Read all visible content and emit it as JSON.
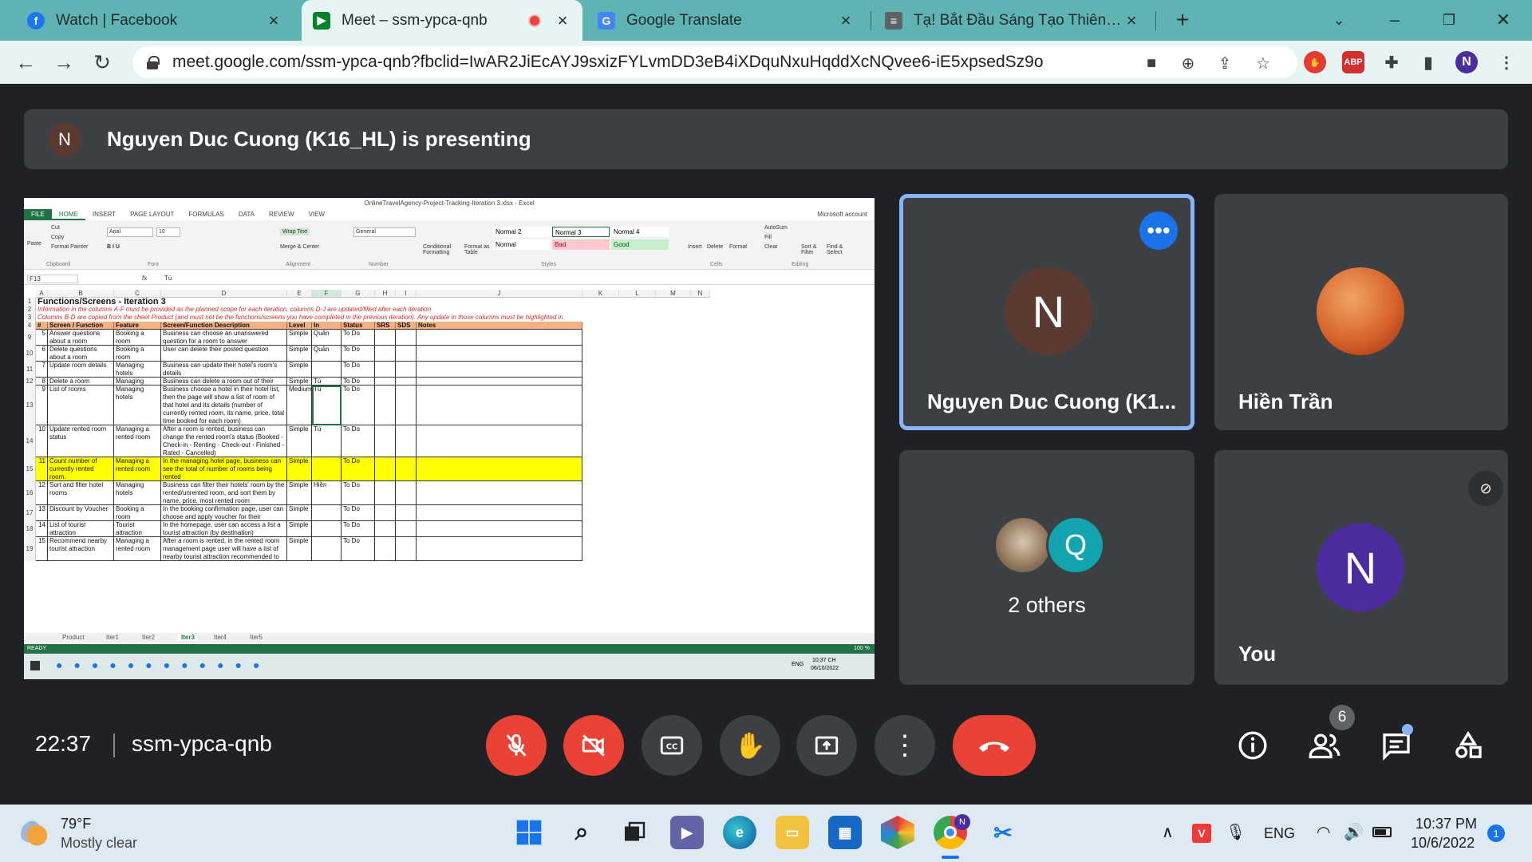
{
  "browser": {
    "tabs": [
      {
        "title": "Watch | Facebook",
        "icon": "facebook-icon",
        "color": "#1877f2"
      },
      {
        "title": "Meet – ssm-ypca-qnb",
        "icon": "google-meet-icon",
        "color": "#00832d",
        "recording": true
      },
      {
        "title": "Google Translate",
        "icon": "google-translate-icon",
        "color": "#4285f4"
      },
      {
        "title": "Tạ! Bắt Đầu Sáng Tạo Thiên Cơ L",
        "icon": "news-icon",
        "color": "#5f6368"
      }
    ],
    "new_tab_label": "+",
    "url": "meet.google.com/ssm-ypca-qnb?fbclid=IwAR2JiEcAYJ9sxizFYLvmDD3eB4iXDquNxuHqddXcNQvee6-iE5xpsedSz9o",
    "profile_initial": "N",
    "extensions": [
      {
        "name": "hand-extension-icon",
        "label": "✋",
        "color": "#e53935"
      },
      {
        "name": "adblock-plus-icon",
        "label": "ABP",
        "color": "#d32f2f"
      }
    ]
  },
  "meet": {
    "presenting_initial": "N",
    "presenting_text": "Nguyen Duc Cuong (K16_HL) is presenting",
    "participants": [
      {
        "name": "Nguyen Duc Cuong (K1...",
        "initial": "N",
        "color": "#5b3a32",
        "active": true
      },
      {
        "name": "Hiền Trần",
        "initial": "",
        "color": "#d3693a"
      },
      {
        "name": "2 others",
        "initial": "Q",
        "color": "#12a4af"
      },
      {
        "name": "You",
        "initial": "N",
        "color": "#4a2c9e",
        "muted": true
      }
    ],
    "time": "22:37",
    "meeting_code": "ssm-ypca-qnb",
    "people_count": "6",
    "colors": {
      "danger": "#ea4335",
      "control_bg": "#3c4043",
      "active_border": "#8ab4f8"
    }
  },
  "excel": {
    "title": "OnlineTravelAgency-Project-Tracking-Iteration 3.xlsx - Excel",
    "account": "Microsoft account",
    "ribbon_tabs": [
      "FILE",
      "HOME",
      "INSERT",
      "PAGE LAYOUT",
      "FORMULAS",
      "DATA",
      "REVIEW",
      "VIEW"
    ],
    "font_name": "Arial",
    "font_size": "10",
    "number_format": "General",
    "styles": [
      "Normal 2",
      "Normal 3",
      "Normal 4",
      "Normal",
      "Bad",
      "Good"
    ],
    "groups": [
      "Clipboard",
      "Font",
      "Alignment",
      "Number",
      "Styles",
      "Cells",
      "Editing"
    ],
    "clipboard": [
      "Cut",
      "Copy",
      "Format Painter",
      "Paste"
    ],
    "alignment": [
      "Wrap Text",
      "Merge & Center"
    ],
    "style_buttons": [
      "Conditional Formatting",
      "Format as Table"
    ],
    "cells_buttons": [
      "Insert",
      "Delete",
      "Format"
    ],
    "editing": [
      "AutoSum",
      "Fill",
      "Clear",
      "Sort & Filter",
      "Find & Select"
    ],
    "cell_ref": "F13",
    "formula": "Tú",
    "columns": [
      "A",
      "B",
      "C",
      "D",
      "E",
      "F",
      "G",
      "H",
      "I",
      "J",
      "K",
      "L",
      "M",
      "N"
    ],
    "heading": "Functions/Screens - Iteration 3",
    "note1": "Information in the columns A-F must be provided as the planned scope for each iteration, columns D-J are updated/filled after each iteration",
    "note2": "Columns B-D are copied from the sheet Product (and must not be the functions/screens you have completed in the previous iteration). Any update in those columns must be highlighted in RED",
    "headers": [
      "#",
      "Screen / Function",
      "Feature",
      "Screen/Function Description",
      "Level",
      "In Charge",
      "Status",
      "SRS",
      "SDS",
      "Notes"
    ],
    "rows": [
      {
        "row": "9",
        "num": "5",
        "screen": "Answer questions about a room",
        "feature": "Booking a room",
        "desc": "Business can choose an unanswered question for a room to answer",
        "level": "Simple",
        "charge": "Quân",
        "status": "To Do"
      },
      {
        "row": "10",
        "num": "6",
        "screen": "Delete questions about a room",
        "feature": "Booking a room",
        "desc": "User can delete their posted question",
        "level": "Simple",
        "charge": "Quân",
        "status": "To Do"
      },
      {
        "row": "11",
        "num": "7",
        "screen": "Update room details",
        "feature": "Managing hotels",
        "desc": "Business can update their hotel's room's details",
        "level": "Simple",
        "charge": "",
        "status": "To Do"
      },
      {
        "row": "12",
        "num": "8",
        "screen": "Delete a room",
        "feature": "Managing hotels",
        "desc": "Business can delete a room out of their hotel",
        "level": "Simple",
        "charge": "Tú",
        "status": "To Do"
      },
      {
        "row": "13",
        "num": "9",
        "screen": "List of rooms",
        "feature": "Managing hotels",
        "desc": "Business choose a hotel in their hotel list, then the page will show a list of room of that hotel and its details (number of currently rented room, its name, price, total time booked for each room)",
        "level": "Medium",
        "charge": "Tú",
        "status": "To Do"
      },
      {
        "row": "14",
        "num": "10",
        "screen": "Update rented room status",
        "feature": "Managing a rented room",
        "desc": "After a room is rented, business can change the rented room's status (Booked - Check-in - Renting - Check-out - Finished - Rated - Cancelled)",
        "level": "Simple",
        "charge": "Tú",
        "status": "To Do"
      },
      {
        "row": "15",
        "num": "11",
        "screen": "Count number of currently rented room.",
        "feature": "Managing a rented room",
        "desc": "In the managing hotel page, business can see the total of number of rooms being rented",
        "level": "Simple",
        "charge": "",
        "status": "To Do",
        "highlight": true
      },
      {
        "row": "16",
        "num": "12",
        "screen": "Sort and filter hotel rooms",
        "feature": "Managing hotels",
        "desc": "Business can filter their hotels' room by the rented/unrented room, and sort them by name, price, most rented room",
        "level": "Simple",
        "charge": "Hiền",
        "status": "To Do"
      },
      {
        "row": "17",
        "num": "13",
        "screen": "Discount by Voucher",
        "feature": "Booking a room",
        "desc": "In the booking confirmation page, user can choose and apply voucher for their payment",
        "level": "Simple",
        "charge": "",
        "status": "To Do"
      },
      {
        "row": "18",
        "num": "14",
        "screen": "List of tourist attraction",
        "feature": "Tourist attraction",
        "desc": "In the homepage, user can access a list a tourist attraction (by destination)",
        "level": "Simple",
        "charge": "",
        "status": "To Do"
      },
      {
        "row": "19",
        "num": "15",
        "screen": "Recommend nearby tourist attraction",
        "feature": "Managing a rented room",
        "desc": "After a room is rented, in the rented room management page user will have a list of nearby tourist attraction recommended to them",
        "level": "Simple",
        "charge": "",
        "status": "To Do"
      }
    ],
    "sheet_tabs": [
      "Product",
      "Iter1",
      "Iter2",
      "Iter3",
      "Iter4",
      "Iter5"
    ],
    "active_sheet": "Iter3",
    "status": "READY",
    "zoom": "100 %",
    "mini_clock": "10:37 CH",
    "mini_date": "06/10/2022",
    "mini_lang": "ENG"
  },
  "taskbar": {
    "weather_temp": "79°F",
    "weather_desc": "Mostly clear",
    "lang": "ENG",
    "time": "10:37 PM",
    "date": "10/6/2022",
    "notification_count": "1"
  }
}
